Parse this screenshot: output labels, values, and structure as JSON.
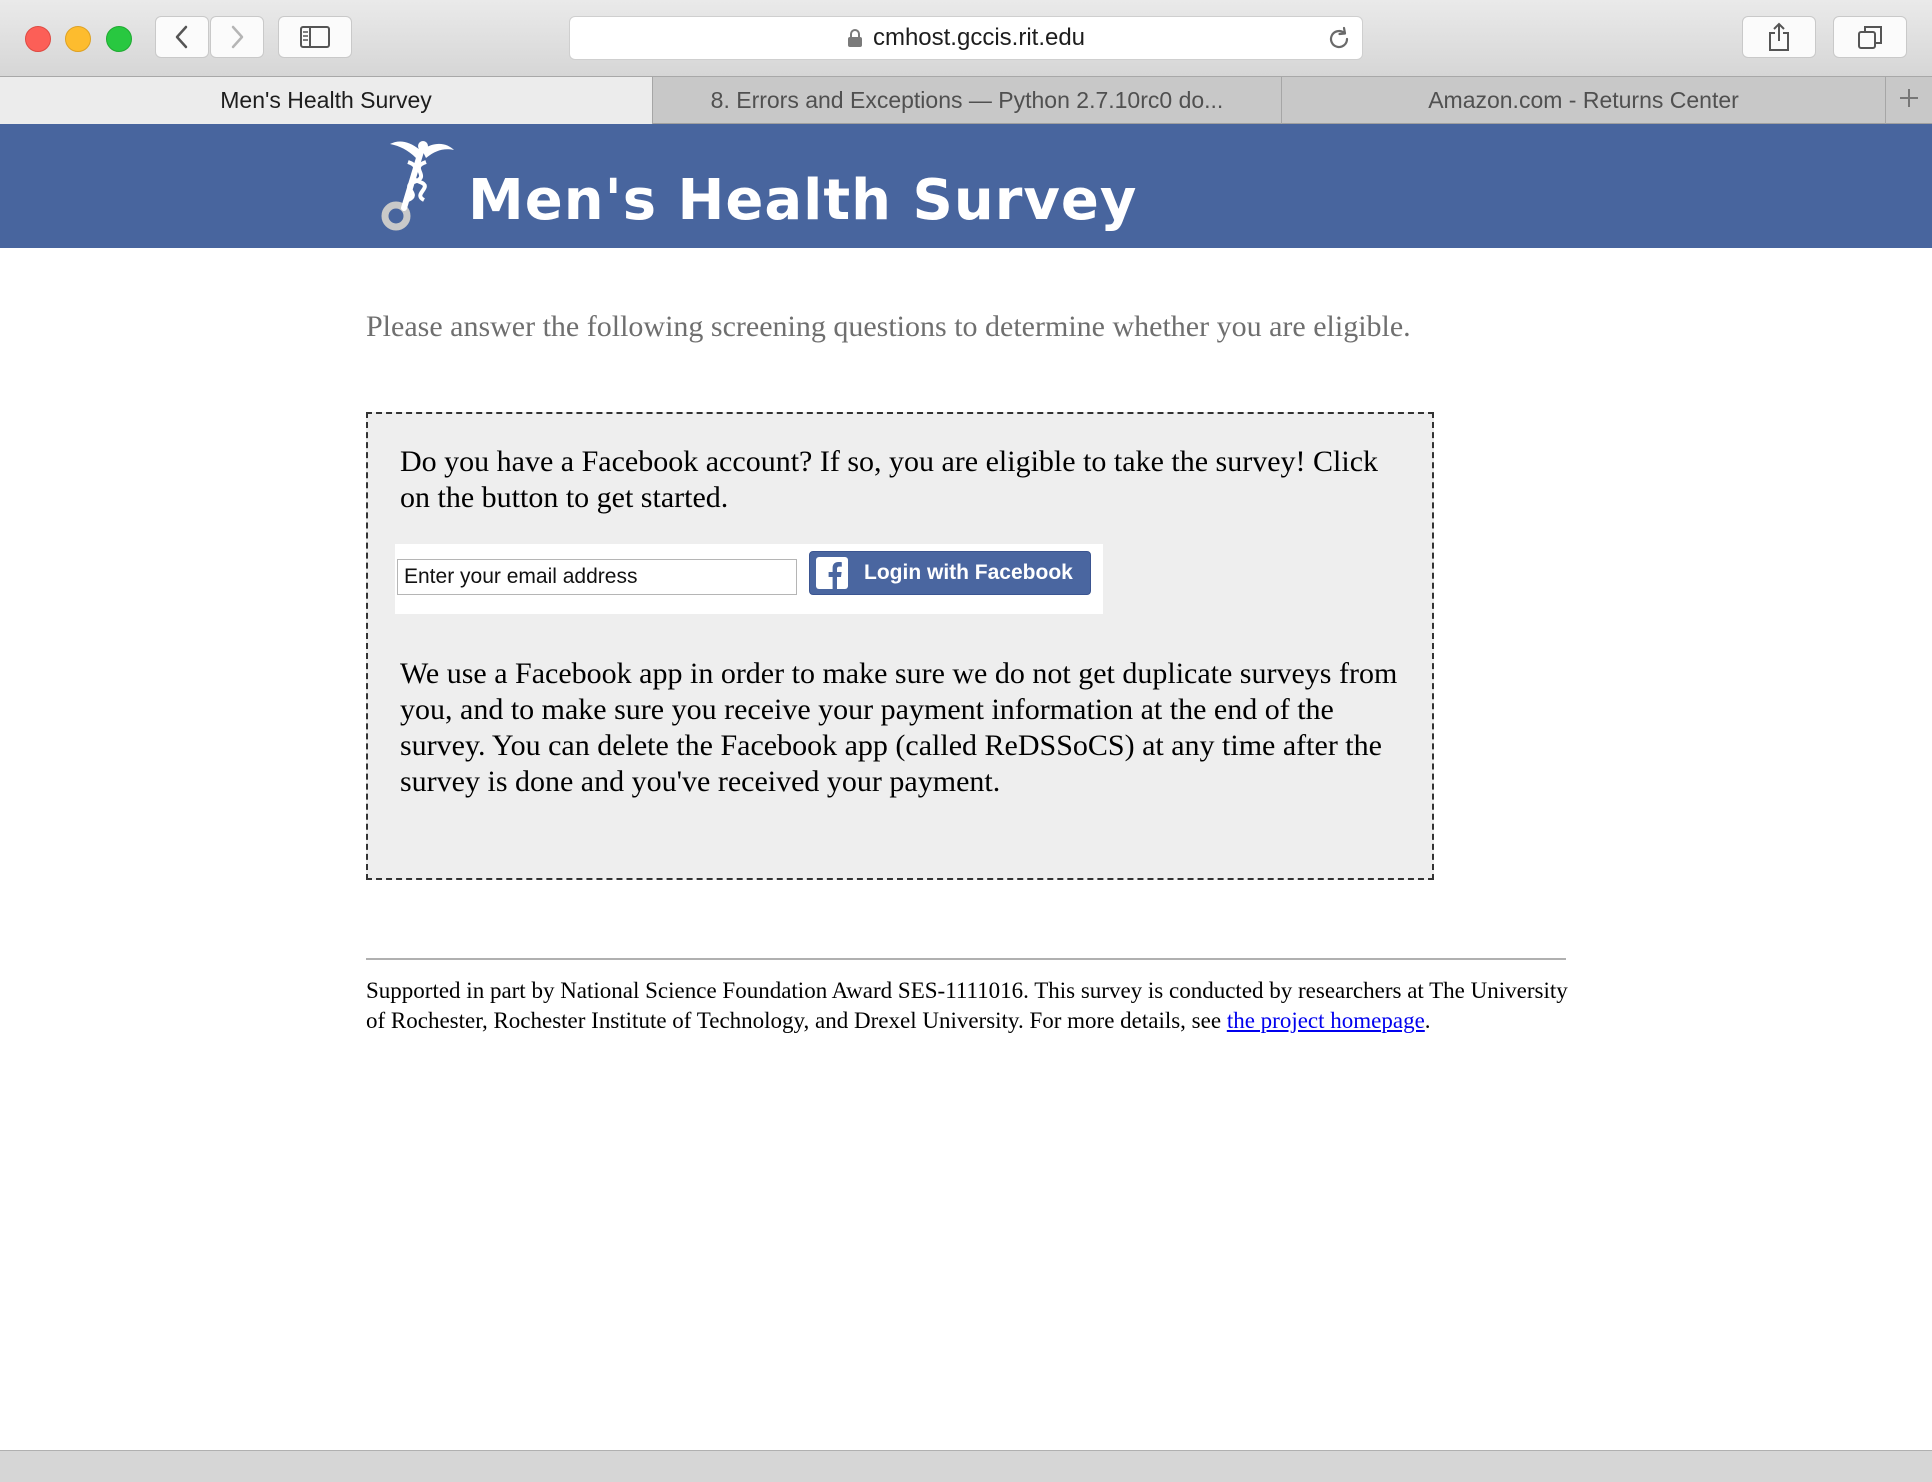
{
  "browser": {
    "url": "cmhost.gccis.rit.edu",
    "tabs": [
      {
        "title": "Men's Health Survey",
        "active": true
      },
      {
        "title": "8. Errors and Exceptions — Python 2.7.10rc0 do...",
        "active": false
      },
      {
        "title": "Amazon.com - Returns Center",
        "active": false
      }
    ]
  },
  "banner": {
    "title": "Men's Health Survey",
    "background": "#48659e"
  },
  "intro": "Please answer the following screening questions to determine whether you are eligible.",
  "card": {
    "question": "Do you have a Facebook account? If so, you are eligible to take the survey! Click on the button to get started.",
    "email_placeholder": "Enter your email address",
    "login_button": "Login with Facebook",
    "info": "We use a Facebook app in order to make sure we do not get duplicate surveys from you, and to make sure you receive your payment information at the end of the survey. You can delete the Facebook app (called ReDSSoCS) at any time after the survey is done and you've received your payment."
  },
  "footer": {
    "text_before": "Supported in part by National Science Foundation Award SES-1111016. This survey is conducted by researchers at The University of Rochester, Rochester Institute of Technology, and Drexel University. For more details, see ",
    "link": "the project homepage",
    "text_after": "."
  },
  "icons": {
    "back": "chevron-left-icon",
    "forward": "chevron-right-icon",
    "sidebar": "sidebar-icon",
    "lock": "lock-icon",
    "reload": "reload-icon",
    "share": "share-icon",
    "tabs": "tabs-overview-icon",
    "new_tab": "plus-icon",
    "logo": "caduceus-icon",
    "facebook": "facebook-icon"
  }
}
